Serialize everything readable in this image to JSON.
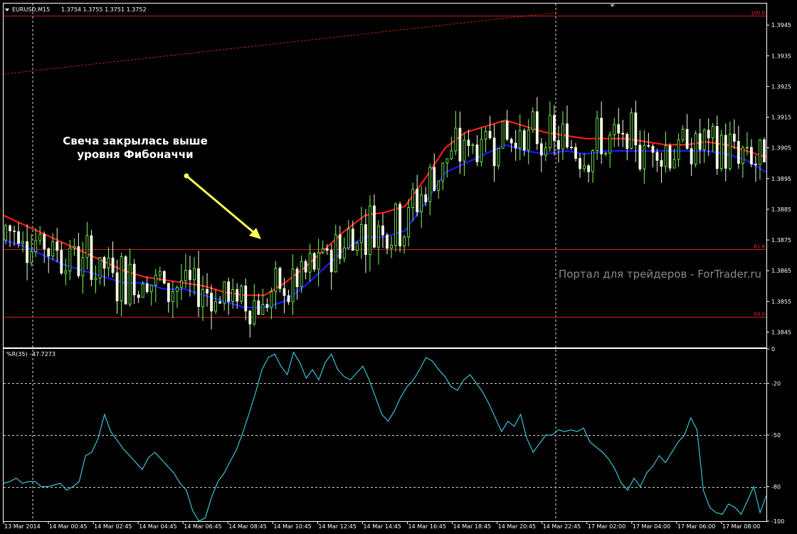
{
  "header": {
    "symbol": "EURUSD,M15",
    "ohlc": "1.3754 1.3755 1.3751 1.3752"
  },
  "indicator_header": {
    "name": "%R(35)",
    "value": "-47.7273"
  },
  "annotation": {
    "line1": "Свеча закрылась выше",
    "line2": "уровня Фибоначчи"
  },
  "watermark": "Портал для трейдеров - ForTrader.ru",
  "colors": {
    "background": "#000000",
    "candle_up": "#7fff5c",
    "candle_down": "#f2ffe0",
    "ma_fast": "#ff1a1a",
    "ma_slow": "#1a1aff",
    "fib_lines": "#c81e1e",
    "wpr_line": "#3fd2e8",
    "arrow": "#ffff55"
  },
  "chart_data": [
    {
      "type": "candlestick",
      "symbol": "EURUSD",
      "timeframe": "M15",
      "ylim": [
        1.384,
        1.3952
      ],
      "y_ticks": [
        "1.3945",
        "1.3935",
        "1.3925",
        "1.3915",
        "1.3905",
        "1.3895",
        "1.3885",
        "1.3875",
        "1.3865",
        "1.3855",
        "1.3845"
      ],
      "x_ticks": [
        "13 Mar 2014",
        "14 Mar 00:45",
        "14 Mar 02:45",
        "14 Mar 04:45",
        "14 Mar 06:45",
        "14 Mar 08:45",
        "14 Mar 10:45",
        "14 Mar 12:45",
        "14 Mar 14:45",
        "14 Mar 16:45",
        "14 Mar 18:45",
        "14 Mar 20:45",
        "14 Mar 22:45",
        "17 Mar 02:00",
        "17 Mar 04:00",
        "17 Mar 06:00",
        "17 Mar 08:00"
      ],
      "fib_levels": [
        {
          "label": "100.0",
          "price": 1.3948
        },
        {
          "label": "61.8",
          "price": 1.3872
        },
        {
          "label": "50.0",
          "price": 1.385
        }
      ],
      "ma_fast": [
        1.3883,
        1.388,
        1.3877,
        1.3874,
        1.3871,
        1.3868,
        1.3865,
        1.3863,
        1.3862,
        1.3861,
        1.386,
        1.3858,
        1.3857,
        1.3857,
        1.3861,
        1.3866,
        1.3872,
        1.3878,
        1.3883,
        1.3884,
        1.3886,
        1.3895,
        1.3905,
        1.391,
        1.3912,
        1.3914,
        1.3912,
        1.391,
        1.3909,
        1.3908,
        1.3908,
        1.3908,
        1.3907,
        1.3906,
        1.3906,
        1.3907,
        1.3906,
        1.3904,
        1.3902
      ],
      "ma_slow": [
        1.3875,
        1.3873,
        1.387,
        1.3867,
        1.3865,
        1.3863,
        1.3861,
        1.3861,
        1.3859,
        1.3859,
        1.3857,
        1.3855,
        1.3853,
        1.3853,
        1.3855,
        1.386,
        1.3866,
        1.3872,
        1.3876,
        1.3876,
        1.3878,
        1.3887,
        1.3897,
        1.39,
        1.3903,
        1.3906,
        1.3904,
        1.3903,
        1.3904,
        1.3903,
        1.3904,
        1.3904,
        1.3904,
        1.3904,
        1.3904,
        1.3904,
        1.3903,
        1.3901,
        1.3897
      ]
    },
    {
      "type": "line",
      "name": "%R(35)",
      "ylim": [
        -100,
        0
      ],
      "y_ticks": [
        "0",
        "-20",
        "-50",
        "-80",
        "-100"
      ],
      "levels": [
        -20,
        -50,
        -80
      ],
      "values": [
        -78,
        -77,
        -75,
        -78,
        -77,
        -77,
        -80,
        -80,
        -79,
        -78,
        -82,
        -80,
        -77,
        -62,
        -60,
        -52,
        -38,
        -48,
        -53,
        -58,
        -62,
        -66,
        -70,
        -63,
        -60,
        -64,
        -68,
        -72,
        -78,
        -82,
        -94,
        -100,
        -98,
        -86,
        -77,
        -72,
        -65,
        -58,
        -48,
        -37,
        -25,
        -12,
        -5,
        -3,
        -10,
        -15,
        -2,
        -8,
        -17,
        -12,
        -18,
        -8,
        -3,
        -12,
        -16,
        -18,
        -14,
        -10,
        -18,
        -28,
        -38,
        -42,
        -36,
        -28,
        -22,
        -18,
        -12,
        -5,
        -7,
        -12,
        -16,
        -22,
        -24,
        -18,
        -15,
        -20,
        -25,
        -32,
        -40,
        -48,
        -42,
        -45,
        -38,
        -52,
        -60,
        -55,
        -50,
        -50,
        -47,
        -48,
        -47,
        -48,
        -46,
        -54,
        -57,
        -60,
        -64,
        -70,
        -78,
        -82,
        -75,
        -80,
        -72,
        -68,
        -62,
        -66,
        -60,
        -54,
        -50,
        -40,
        -47,
        -82,
        -92,
        -95,
        -96,
        -90,
        -92,
        -96,
        -88,
        -80,
        -95,
        -85
      ]
    }
  ]
}
